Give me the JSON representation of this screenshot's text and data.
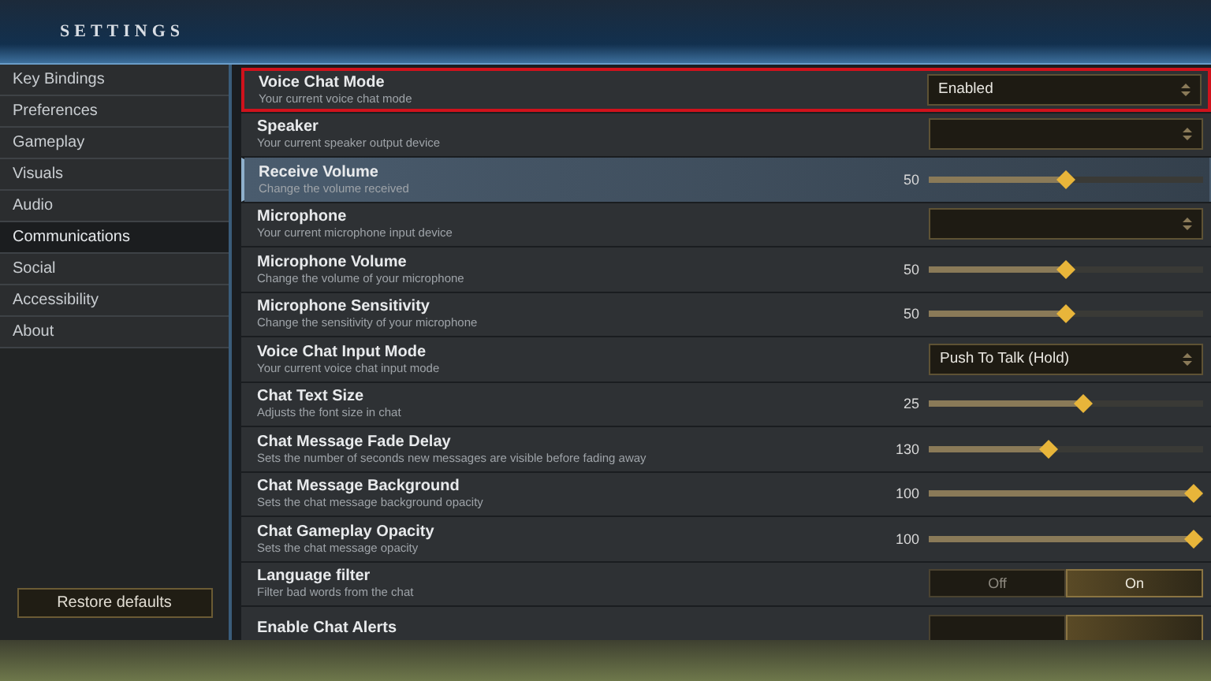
{
  "header": {
    "title": "SETTINGS"
  },
  "sidebar": {
    "items": [
      {
        "label": "Key Bindings",
        "selected": false
      },
      {
        "label": "Preferences",
        "selected": false
      },
      {
        "label": "Gameplay",
        "selected": false
      },
      {
        "label": "Visuals",
        "selected": false
      },
      {
        "label": "Audio",
        "selected": false
      },
      {
        "label": "Communications",
        "selected": true
      },
      {
        "label": "Social",
        "selected": false
      },
      {
        "label": "Accessibility",
        "selected": false
      },
      {
        "label": "About",
        "selected": false
      }
    ],
    "restore_button": "Restore defaults"
  },
  "settings": [
    {
      "kind": "select",
      "title": "Voice Chat Mode",
      "description": "Your current voice chat mode",
      "value": "Enabled",
      "outlined": true,
      "hovered": false
    },
    {
      "kind": "select",
      "title": "Speaker",
      "description": "Your current speaker output device",
      "outlined": false,
      "hovered": false
    },
    {
      "kind": "slider",
      "title": "Receive Volume",
      "description": "Change the volume received",
      "reading": "50",
      "level": 0.5,
      "outlined": false,
      "hovered": true
    },
    {
      "kind": "select",
      "title": "Microphone",
      "description": "Your current microphone input device",
      "outlined": false,
      "hovered": false
    },
    {
      "kind": "slider",
      "title": "Microphone Volume",
      "description": "Change the volume of your microphone",
      "reading": "50",
      "level": 0.5,
      "outlined": false,
      "hovered": false
    },
    {
      "kind": "slider",
      "title": "Microphone Sensitivity",
      "description": "Change the sensitivity of your microphone",
      "reading": "50",
      "level": 0.5,
      "outlined": false,
      "hovered": false
    },
    {
      "kind": "select",
      "title": "Voice Chat Input Mode",
      "description": "Your current voice chat input mode",
      "value": "Push To Talk (Hold)",
      "outlined": false,
      "hovered": false
    },
    {
      "kind": "slider",
      "title": "Chat Text Size",
      "description": "Adjusts the font size in chat",
      "reading": "25",
      "level": 0.57,
      "outlined": false,
      "hovered": false
    },
    {
      "kind": "slider",
      "title": "Chat Message Fade Delay",
      "description": "Sets the number of seconds new messages are visible before fading away",
      "reading": "130",
      "level": 0.43,
      "outlined": false,
      "hovered": false
    },
    {
      "kind": "slider",
      "title": "Chat Message Background",
      "description": "Sets the chat message background opacity",
      "reading": "100",
      "level": 1,
      "outlined": false,
      "hovered": false
    },
    {
      "kind": "slider",
      "title": "Chat Gameplay Opacity",
      "description": "Sets the chat message opacity",
      "reading": "100",
      "level": 1,
      "outlined": false,
      "hovered": false
    },
    {
      "kind": "toggle",
      "title": "Language filter",
      "description": "Filter bad words from the chat",
      "options": [
        {
          "label": "Off",
          "selected": false
        },
        {
          "label": "On",
          "selected": true
        }
      ],
      "outlined": false,
      "hovered": false
    },
    {
      "kind": "toggle",
      "title": "Enable Chat Alerts",
      "options": [
        {
          "selected": false
        },
        {
          "selected": true
        }
      ],
      "outlined": false,
      "hovered": false
    }
  ]
}
